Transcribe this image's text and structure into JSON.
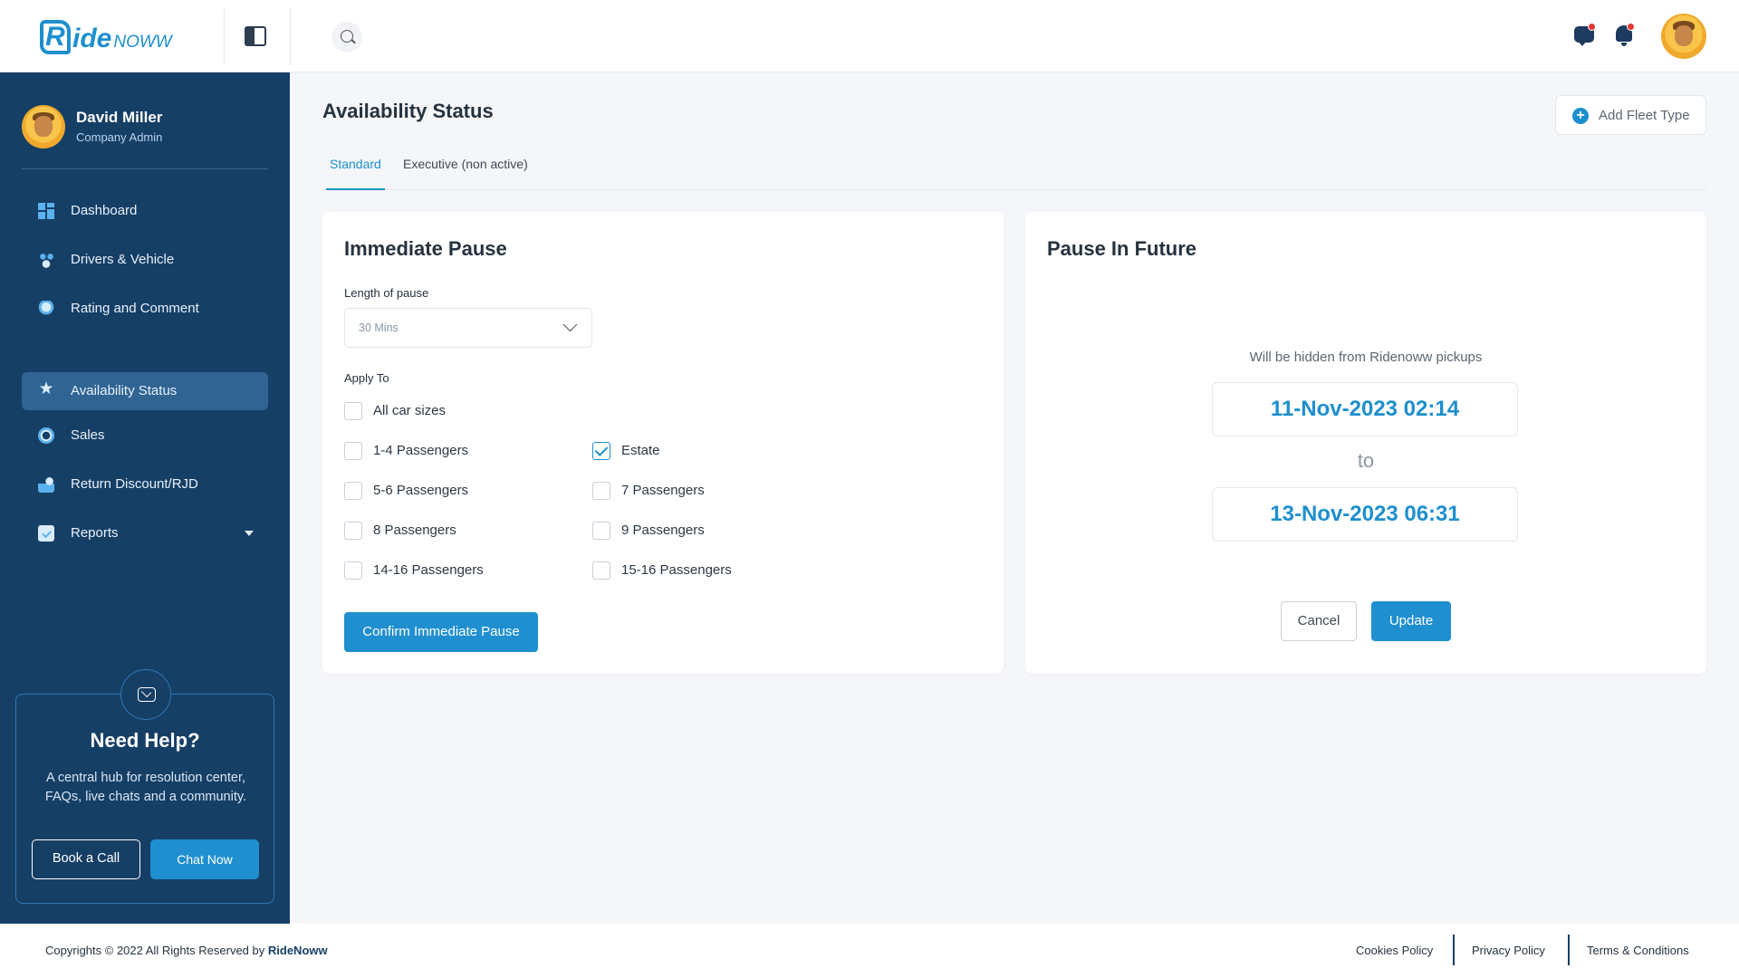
{
  "app": {
    "logo_r": "R",
    "logo_ide": "ide",
    "logo_noww": "NOWW"
  },
  "user": {
    "name": "David Miller",
    "role": "Company Admin"
  },
  "sidebar": {
    "items": [
      {
        "label": "Dashboard",
        "icon": "dashboard-icon"
      },
      {
        "label": "Drivers & Vehicle",
        "icon": "drivers-icon"
      },
      {
        "label": "Rating and Comment",
        "icon": "rating-icon"
      },
      {
        "label": "Availability Status",
        "icon": "star-icon",
        "active": true
      },
      {
        "label": "Sales",
        "icon": "sales-icon"
      },
      {
        "label": "Return Discount/RJD",
        "icon": "return-discount-icon"
      },
      {
        "label": "Reports",
        "icon": "reports-icon"
      }
    ],
    "star_glyph": "★"
  },
  "help": {
    "title": "Need Help?",
    "text": "A central hub for resolution center, FAQs, live chats and a community.",
    "book_label": "Book a Call",
    "chat_label": "Chat Now"
  },
  "page": {
    "title": "Availability Status",
    "add_fleet_label": "Add Fleet Type",
    "add_fleet_glyph": "+",
    "tabs": [
      {
        "label": "Standard",
        "active": true
      },
      {
        "label": "Executive (non active)",
        "active": false
      }
    ]
  },
  "immediate": {
    "title": "Immediate Pause",
    "length_label": "Length of pause",
    "length_value": "30 Mins",
    "apply_label": "Apply To",
    "options": [
      {
        "label": "All car sizes",
        "checked": false
      },
      {
        "label": "1-4 Passengers",
        "checked": false
      },
      {
        "label": "Estate",
        "checked": true
      },
      {
        "label": "5-6 Passengers",
        "checked": false
      },
      {
        "label": "7 Passengers",
        "checked": false
      },
      {
        "label": "8 Passengers",
        "checked": false
      },
      {
        "label": "9 Passengers",
        "checked": false
      },
      {
        "label": "14-16 Passengers",
        "checked": false
      },
      {
        "label": "15-16 Passengers",
        "checked": false
      }
    ],
    "confirm_label": "Confirm Immediate Pause"
  },
  "future": {
    "title": "Pause In Future",
    "note": "Will be hidden from Ridenoww pickups",
    "from": "11-Nov-2023 02:14",
    "to_label": "to",
    "to": "13-Nov-2023 06:31",
    "cancel_label": "Cancel",
    "update_label": "Update"
  },
  "footer": {
    "copyright_prefix": "Copyrights © 2022 All Rights Reserved by",
    "brand": "RideNoww",
    "links": [
      "Cookies Policy",
      "Privacy Policy",
      "Terms & Conditions"
    ]
  },
  "colors": {
    "primary": "#1d8fce",
    "sidebar": "#163f66",
    "sidebar_active": "#2f6493"
  }
}
